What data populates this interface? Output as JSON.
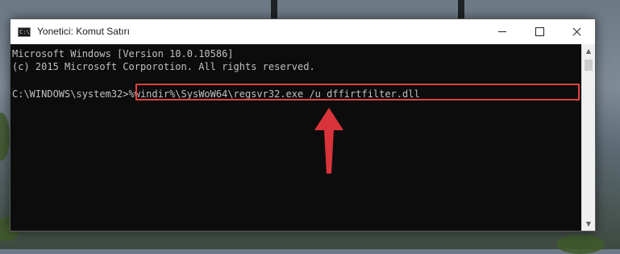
{
  "window": {
    "title": "Yonetici: Komut Satırı",
    "icon": "cmd-icon",
    "icon_text": "C:\\",
    "controls": {
      "minimize": "minimize-icon",
      "maximize": "maximize-icon",
      "close": "close-icon"
    }
  },
  "console": {
    "lines": [
      "Microsoft Windows [Version 10.0.10586]",
      "(c) 2015 Microsoft Corporotion. All rights reserved.",
      "",
      "C:\\WINDOWS\\system32>%windir%\\SysWoW64\\regsvr32.exe /u dffirtfilter.dll"
    ]
  },
  "colors": {
    "console_bg": "#0c0c0c",
    "console_text": "#c0c0c0",
    "highlight": "#e0423f",
    "arrow": "#d9343a"
  }
}
